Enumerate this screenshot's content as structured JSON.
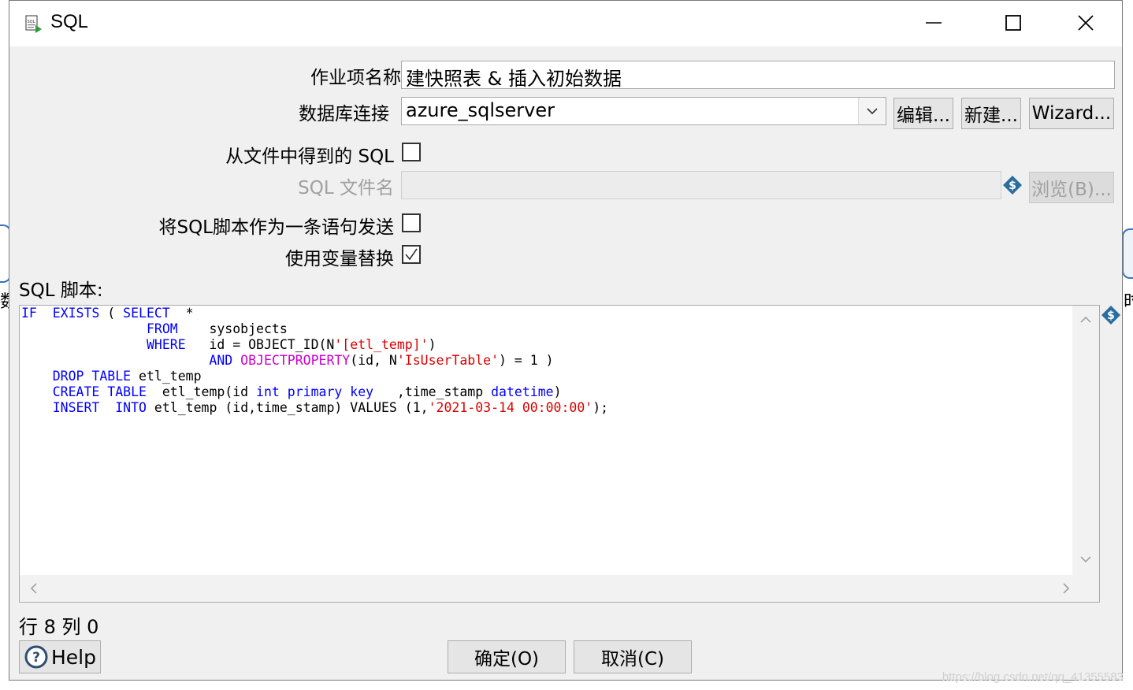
{
  "background": {
    "left_char": "数",
    "right_char": "时"
  },
  "window": {
    "title": "SQL",
    "title_icon": "sql-icon"
  },
  "form": {
    "job_name_label": "作业项名称",
    "job_name_value": "建快照表 & 插入初始数据",
    "db_conn_label": "数据库连接",
    "db_conn_value": "azure_sqlserver",
    "edit_button": "编辑...",
    "new_button": "新建...",
    "wizard_button": "Wizard...",
    "sql_from_file_label": "从文件中得到的 SQL",
    "sql_from_file_checked": false,
    "sql_filename_label": "SQL 文件名",
    "sql_filename_value": "",
    "browse_button": "浏览(B)...",
    "send_as_single_label": "将SQL脚本作为一条语句发送",
    "send_as_single_checked": false,
    "use_var_sub_label": "使用变量替换",
    "use_var_sub_checked": true,
    "sql_script_label": "SQL 脚本:"
  },
  "editor": {
    "lines": [
      [
        {
          "t": "IF",
          "c": "kw"
        },
        {
          "t": "  "
        },
        {
          "t": "EXISTS",
          "c": "kw"
        },
        {
          "t": " ( "
        },
        {
          "t": "SELECT",
          "c": "kw"
        },
        {
          "t": "  *"
        }
      ],
      [
        {
          "t": "                "
        },
        {
          "t": "FROM",
          "c": "kw"
        },
        {
          "t": "    sysobjects"
        }
      ],
      [
        {
          "t": "                "
        },
        {
          "t": "WHERE",
          "c": "kw"
        },
        {
          "t": "   id = OBJECT_ID(N"
        },
        {
          "t": "'[etl_temp]'",
          "c": "str"
        },
        {
          "t": ")"
        }
      ],
      [
        {
          "t": "                        "
        },
        {
          "t": "AND",
          "c": "kw"
        },
        {
          "t": " "
        },
        {
          "t": "OBJECTPROPERTY",
          "c": "fn"
        },
        {
          "t": "(id, N"
        },
        {
          "t": "'IsUserTable'",
          "c": "str"
        },
        {
          "t": ") = 1 )"
        }
      ],
      [
        {
          "t": "    "
        },
        {
          "t": "DROP",
          "c": "kw"
        },
        {
          "t": " "
        },
        {
          "t": "TABLE",
          "c": "kw"
        },
        {
          "t": " etl_temp"
        }
      ],
      [
        {
          "t": "    "
        },
        {
          "t": "CREATE",
          "c": "kw"
        },
        {
          "t": " "
        },
        {
          "t": "TABLE",
          "c": "kw"
        },
        {
          "t": "  etl_temp(id "
        },
        {
          "t": "int",
          "c": "kw"
        },
        {
          "t": " "
        },
        {
          "t": "primary",
          "c": "kw"
        },
        {
          "t": " "
        },
        {
          "t": "key",
          "c": "kw"
        },
        {
          "t": "   ,time_stamp "
        },
        {
          "t": "datetime",
          "c": "kw"
        },
        {
          "t": ")"
        }
      ],
      [
        {
          "t": "    "
        },
        {
          "t": "INSERT",
          "c": "kw"
        },
        {
          "t": "  "
        },
        {
          "t": "INTO",
          "c": "kw"
        },
        {
          "t": " etl_temp (id,time_stamp) VALUES (1,"
        },
        {
          "t": "'2021-03-14 00:00:00'",
          "c": "str"
        },
        {
          "t": ");"
        }
      ]
    ]
  },
  "status": {
    "text": "行 8 列 0"
  },
  "footer": {
    "help_button": "Help",
    "ok_button": "确定(O)",
    "cancel_button": "取消(C)"
  },
  "watermark": "https://blog.csdn.net/qq_41355583",
  "colors": {
    "keyword": "#0000ff",
    "string": "#d80000",
    "function": "#cc00cc",
    "dialog_bg": "#f0f0f0"
  },
  "icons": {
    "minimize": "minimize-icon",
    "maximize": "maximize-icon",
    "close": "close-icon",
    "variable": "variable-dollar-icon",
    "help": "help-question-icon",
    "dropdown": "chevron-down-icon"
  }
}
